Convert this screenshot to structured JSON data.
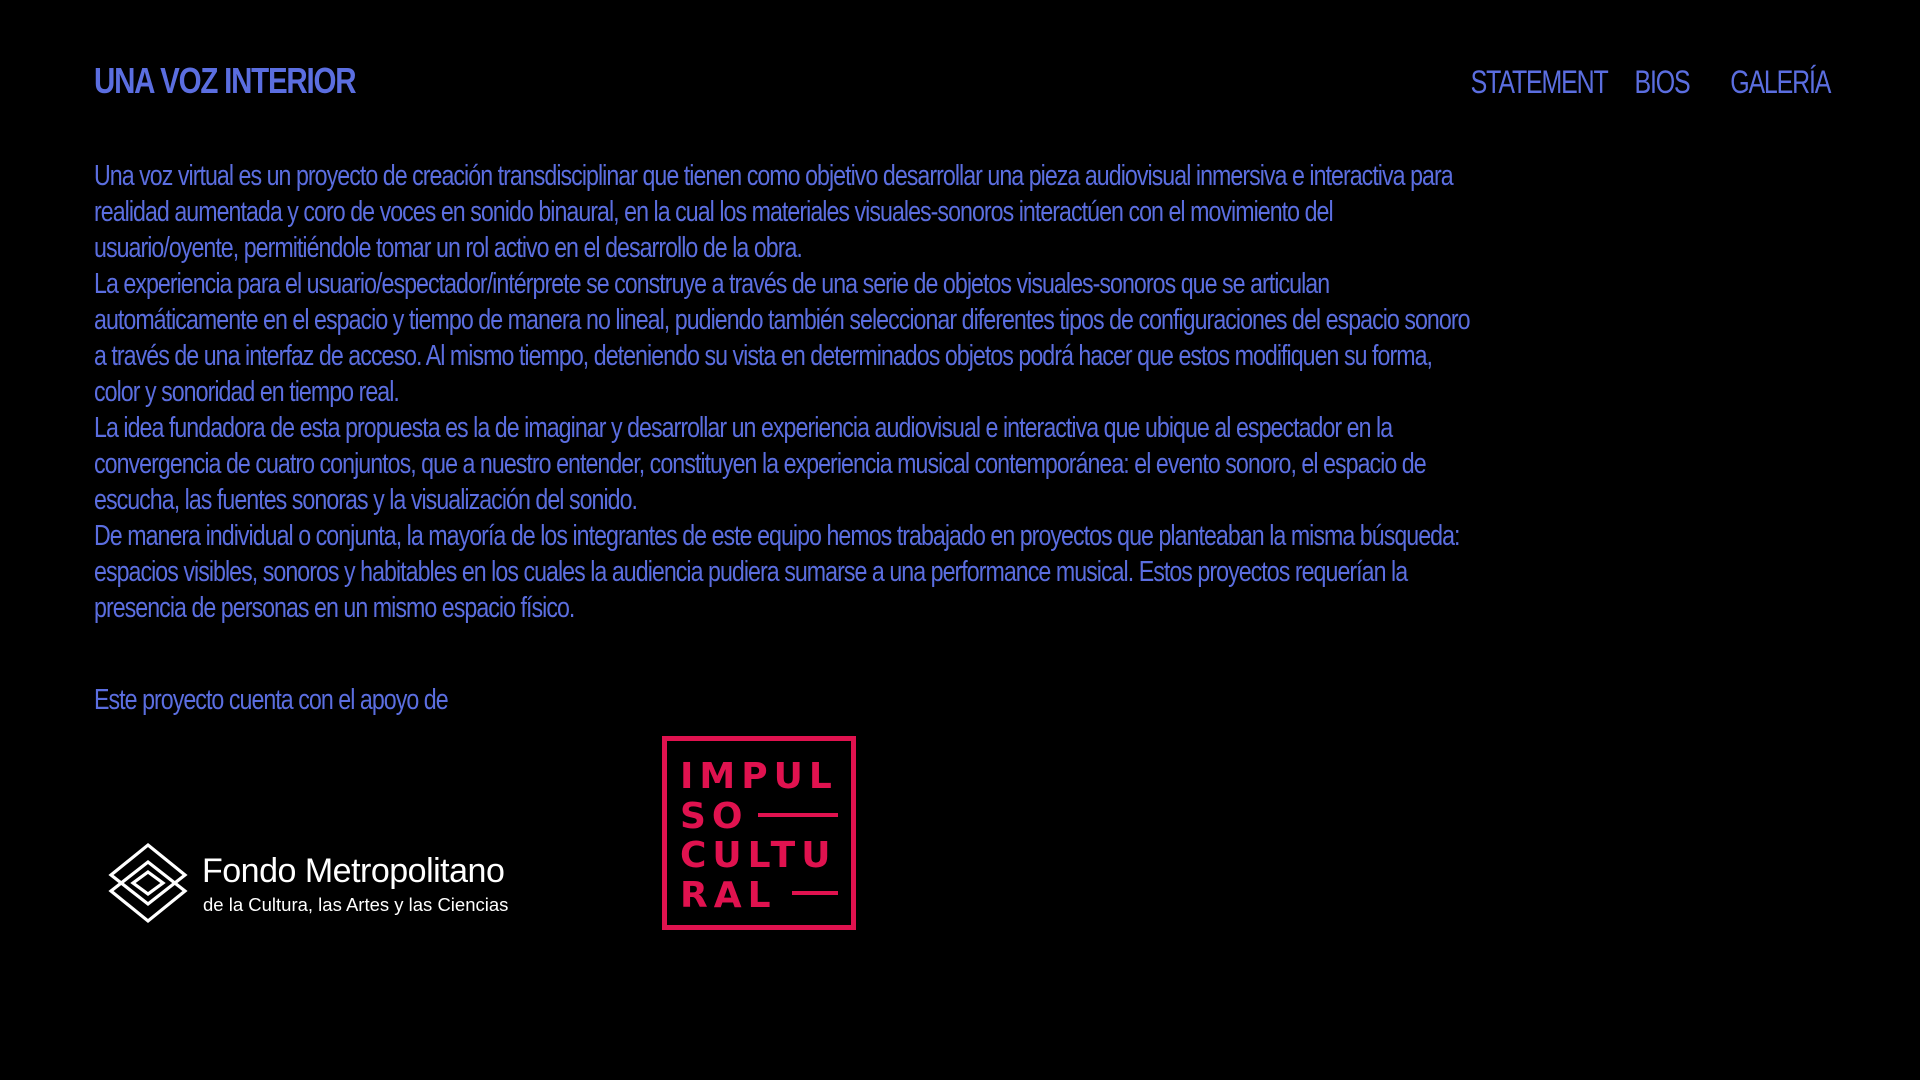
{
  "header": {
    "site_title": "UNA VOZ INTERIOR",
    "nav": [
      {
        "label": "STATEMENT"
      },
      {
        "label": "BIOS"
      },
      {
        "label": "GALERÍA"
      }
    ]
  },
  "statement": {
    "paragraphs": [
      "Una voz virtual es un proyecto de creación transdisciplinar que tienen como objetivo desarrollar una pieza audiovisual inmersiva e interactiva para realidad aumentada y coro de voces en sonido binaural, en la cual los materiales visuales-sonoros interactúen con el movimiento del usuario/oyente, permitiéndole tomar un rol activo en el desarrollo de la obra.",
      "La experiencia para el usuario/espectador/intérprete se construye a través de una serie de objetos visuales-sonoros que se articulan automáticamente en el espacio y tiempo de manera no lineal, pudiendo también seleccionar diferentes tipos de configuraciones del espacio sonoro a través de una interfaz de acceso.    Al mismo tiempo, deteniendo su vista en determinados objetos podrá hacer que estos modifiquen su forma, color y sonoridad en tiempo real.",
      "La idea fundadora de esta propuesta es la de imaginar y desarrollar un experiencia audiovisual e interactiva que ubique al espectador en la convergencia de cuatro conjuntos, que a nuestro entender, constituyen la experiencia musical contemporánea: el evento sonoro, el espacio de escucha, las fuentes sonoras y la visualización del sonido.",
      "De manera individual o conjunta, la mayoría de los integrantes de este equipo hemos trabajado en proyectos que planteaban la misma búsqueda: espacios visibles, sonoros y habitables en los cuales la audiencia pudiera sumarse a una performance musical.  Estos proyectos requerían la presencia de personas en un mismo espacio físico."
    ]
  },
  "support": {
    "label": "Este proyecto cuenta con el apoyo de",
    "fondo": {
      "name": "Fondo Metropolitano",
      "subtitle": "de la Cultura, las Artes y las Ciencias"
    },
    "impulso": {
      "lines": [
        "IMPUL",
        "SO",
        "CULTU",
        "RAL"
      ]
    }
  },
  "colors": {
    "background": "#000000",
    "text": "#5b6ee0",
    "logo_white": "#ffffff",
    "impulso_red": "#e0124f"
  }
}
